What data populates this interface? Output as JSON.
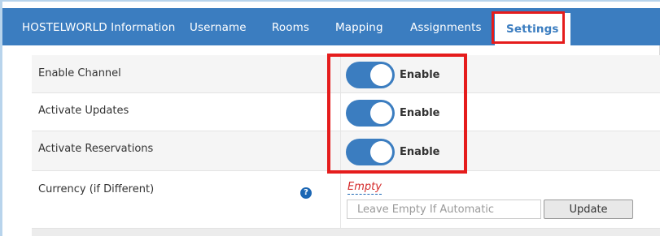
{
  "tabs": [
    {
      "label": "HOSTELWORLD Information"
    },
    {
      "label": "Username"
    },
    {
      "label": "Rooms"
    },
    {
      "label": "Mapping"
    },
    {
      "label": "Assignments"
    },
    {
      "label": "Settings",
      "active": true
    }
  ],
  "settings": {
    "rows": [
      {
        "label": "Enable Channel",
        "toggle_on": true,
        "toggle_label": "Enable"
      },
      {
        "label": "Activate Updates",
        "toggle_on": true,
        "toggle_label": "Enable"
      },
      {
        "label": "Activate Reservations",
        "toggle_on": true,
        "toggle_label": "Enable"
      }
    ],
    "currency": {
      "label": "Currency (if Different)",
      "help_icon": "question-circle-icon",
      "editable_value": "Empty",
      "input_value": "",
      "input_placeholder": "Leave Empty If Automatic",
      "update_label": "Update"
    }
  },
  "colors": {
    "tabbar": "#3b7dc0",
    "toggle_on": "#3b7dc0",
    "highlight_box": "#e51c1c",
    "empty_text": "#d42a2a"
  }
}
